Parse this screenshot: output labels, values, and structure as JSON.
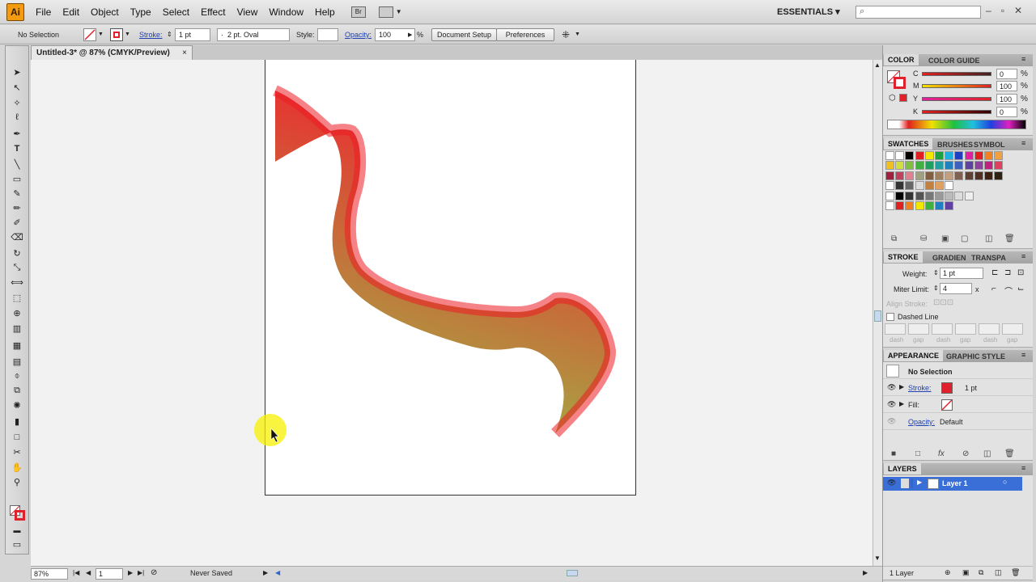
{
  "app": {
    "logo": "Ai"
  },
  "menu": {
    "items": [
      "File",
      "Edit",
      "Object",
      "Type",
      "Select",
      "Effect",
      "View",
      "Window",
      "Help"
    ],
    "bridge_label": "Br"
  },
  "workspace": {
    "name": "ESSENTIALS"
  },
  "controls": {
    "selection_label": "No Selection",
    "stroke_label": "Stroke:",
    "stroke_weight": "1 pt",
    "brush_dot": "·",
    "brush_name": "2 pt. Oval",
    "style_label": "Style:",
    "opacity_label": "Opacity:",
    "opacity_value": "100",
    "opacity_unit": "%",
    "document_setup": "Document Setup",
    "preferences": "Preferences"
  },
  "document": {
    "tab_title": "Untitled-3* @ 87% (CMYK/Preview)",
    "close": "×"
  },
  "status": {
    "zoom": "87%",
    "page": "1",
    "save_state": "Never Saved"
  },
  "color_panel": {
    "tabs": [
      "COLOR",
      "COLOR GUIDE"
    ],
    "channels": [
      {
        "label": "C",
        "value": "0"
      },
      {
        "label": "M",
        "value": "100"
      },
      {
        "label": "Y",
        "value": "100"
      },
      {
        "label": "K",
        "value": "0"
      }
    ],
    "unit": "%"
  },
  "swatches_panel": {
    "tabs": [
      "SWATCHES",
      "BRUSHES",
      "SYMBOL"
    ]
  },
  "stroke_panel": {
    "tabs": [
      "STROKE",
      "GRADIEN",
      "TRANSPA"
    ],
    "weight_label": "Weight:",
    "weight_value": "1 pt",
    "miter_label": "Miter Limit:",
    "miter_value": "4",
    "miter_x": "x",
    "align_label": "Align Stroke:",
    "dashed_label": "Dashed Line",
    "dash_labels": [
      "dash",
      "gap",
      "dash",
      "gap",
      "dash",
      "gap"
    ]
  },
  "appearance_panel": {
    "tabs": [
      "APPEARANCE",
      "GRAPHIC STYLE"
    ],
    "title": "No Selection",
    "stroke_label": "Stroke:",
    "stroke_value": "1 pt",
    "fill_label": "Fill:",
    "opacity_label": "Opacity:",
    "opacity_value": "Default"
  },
  "layers_panel": {
    "tab": "LAYERS",
    "layer_name": "Layer 1",
    "count": "1 Layer"
  },
  "colors": {
    "accent_red": "#e0202a",
    "gradient_start": "#8cc63f",
    "gradient_end": "#ed1c24",
    "selection_blue": "#3a6fd8"
  }
}
